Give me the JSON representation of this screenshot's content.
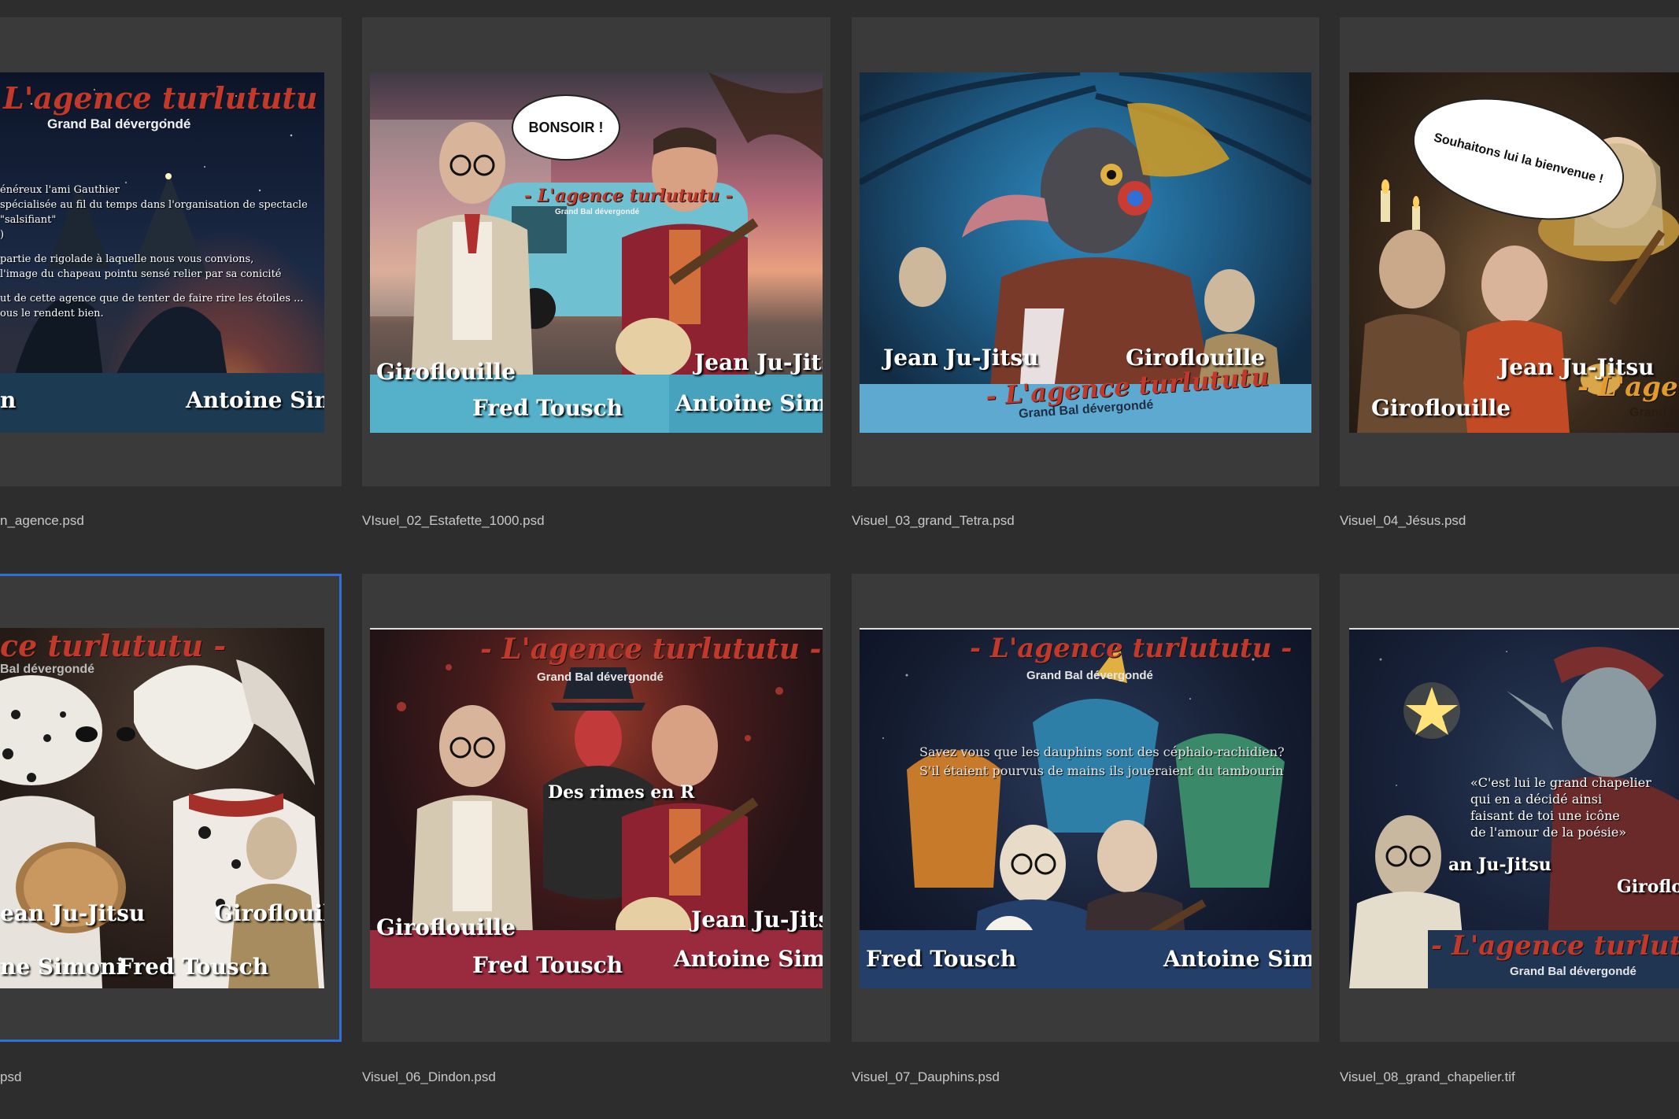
{
  "accent": {
    "selection": "#2f6fd6",
    "title_red": "#c0392b"
  },
  "grid": [
    {
      "filename": "n_agence.psd",
      "title": "L'agence turlututu -",
      "subtitle": "Grand Bal dévergondé",
      "body_lines": [
        "énéreux l'ami Gauthier",
        "spécialisée au fil du temps dans l'organisation de spectacle \"salsifiant\"",
        ")",
        "",
        "partie de rigolade à laquelle nous vous convions,",
        "l'image du chapeau pointu sensé relier par sa conicité",
        "",
        "ut de cette agence que de tenter de faire rire les étoiles ...",
        "ous le rendent bien."
      ],
      "names": [
        "n",
        "Antoine Simoni"
      ]
    },
    {
      "filename": "VIsuel_02_Estafette_1000.psd",
      "bubble": "BONSOIR !",
      "title": "- L'agence turlututu -",
      "subtitle": "Grand Bal dévergondé",
      "names": [
        "Giroflouille",
        "Fred Tousch",
        "Jean Ju-Jitsu",
        "Antoine Simoni"
      ]
    },
    {
      "filename": "Visuel_03_grand_Tetra.psd",
      "title": "- L'agence turlututu",
      "subtitle": "Grand Bal dévergondé",
      "names": [
        "Jean Ju-Jitsu",
        "Giroflouille"
      ]
    },
    {
      "filename": "Visuel_04_Jésus.psd",
      "bubble": "Souhaitons lui la bienvenue !",
      "title": "- L'agence",
      "subtitle": "Grand Bal",
      "names": [
        "Jean Ju-Jitsu",
        "Giroflouille"
      ]
    },
    {
      "filename": "psd",
      "title": "ce turlututu -",
      "subtitle": "Bal dévergondé",
      "names": [
        "ean Ju-Jitsu",
        "Giroflouille",
        "ne Simoni",
        "Fred Tousch"
      ],
      "selected": true
    },
    {
      "filename": "Visuel_06_Dindon.psd",
      "title": "- L'agence turlututu -",
      "subtitle": "Grand Bal dévergondé",
      "caption": "Des rimes en R",
      "names": [
        "Giroflouille",
        "Fred Tousch",
        "Jean Ju-Jitsu",
        "Antoine Simoni"
      ]
    },
    {
      "filename": "Visuel_07_Dauphins.psd",
      "title": "- L'agence turlututu -",
      "subtitle": "Grand Bal dévergondé",
      "overlay": [
        "Savez vous que les dauphins sont des céphalo-rachidien?",
        "S'il étaient pourvus de mains ils joueraient du tambourin"
      ],
      "names": [
        "Fred Tousch",
        "Antoine Simoni"
      ]
    },
    {
      "filename": "Visuel_08_grand_chapelier.tif",
      "quote": [
        "«C'est lui le grand chapelier",
        "qui en a décidé ainsi",
        "faisant de toi une icône",
        "de l'amour de la poésie»"
      ],
      "title": "- L'agence turlututu",
      "subtitle": "Grand Bal dévergondé",
      "names": [
        "an Ju-Jitsu",
        "Giroflouill"
      ]
    }
  ]
}
